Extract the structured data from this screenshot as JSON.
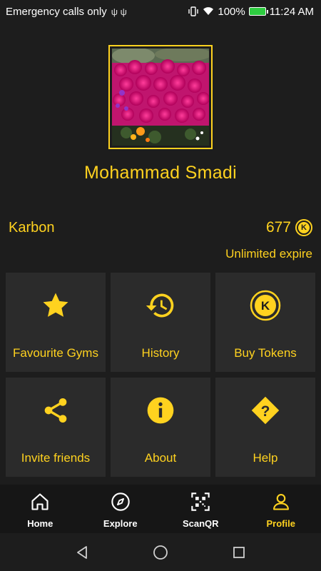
{
  "status_bar": {
    "carrier": "Emergency calls only",
    "battery": "100%",
    "time": "11:24 AM"
  },
  "profile": {
    "name": "Mohammad Smadi",
    "avatar_icon": "flower-photo"
  },
  "wallet": {
    "label": "Karbon",
    "balance": "677",
    "expire": "Unlimited expire",
    "token_icon": "k-coin-icon"
  },
  "tiles": [
    {
      "label": "Favourite Gyms",
      "icon": "star-icon"
    },
    {
      "label": "History",
      "icon": "history-icon"
    },
    {
      "label": "Buy Tokens",
      "icon": "k-coin-icon"
    },
    {
      "label": "Invite friends",
      "icon": "share-icon"
    },
    {
      "label": "About",
      "icon": "info-icon"
    },
    {
      "label": "Help",
      "icon": "help-diamond-icon"
    }
  ],
  "nav": {
    "items": [
      {
        "label": "Home",
        "icon": "home-icon"
      },
      {
        "label": "Explore",
        "icon": "compass-icon"
      },
      {
        "label": "ScanQR",
        "icon": "qr-icon"
      },
      {
        "label": "Profile",
        "icon": "user-icon"
      }
    ],
    "active": "Profile"
  },
  "colors": {
    "accent": "#ffd21f",
    "background": "#1d1d1d",
    "tile": "#2b2b2b",
    "nav": "#161616"
  }
}
